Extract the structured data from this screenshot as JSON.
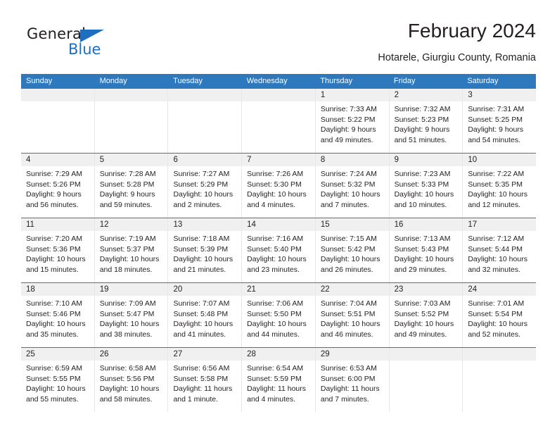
{
  "brand": {
    "name_top": "General",
    "name_bottom": "Blue",
    "accent_color": "#1f6fc0"
  },
  "header": {
    "title": "February 2024",
    "subtitle": "Hotarele, Giurgiu County, Romania"
  },
  "calendar": {
    "header_bg": "#2e78bd",
    "daynumber_bg": "#f0f0f0",
    "weekdays": [
      "Sunday",
      "Monday",
      "Tuesday",
      "Wednesday",
      "Thursday",
      "Friday",
      "Saturday"
    ],
    "weeks": [
      [
        {
          "day": "",
          "lines": []
        },
        {
          "day": "",
          "lines": []
        },
        {
          "day": "",
          "lines": []
        },
        {
          "day": "",
          "lines": []
        },
        {
          "day": "1",
          "lines": [
            "Sunrise: 7:33 AM",
            "Sunset: 5:22 PM",
            "Daylight: 9 hours",
            "and 49 minutes."
          ]
        },
        {
          "day": "2",
          "lines": [
            "Sunrise: 7:32 AM",
            "Sunset: 5:23 PM",
            "Daylight: 9 hours",
            "and 51 minutes."
          ]
        },
        {
          "day": "3",
          "lines": [
            "Sunrise: 7:31 AM",
            "Sunset: 5:25 PM",
            "Daylight: 9 hours",
            "and 54 minutes."
          ]
        }
      ],
      [
        {
          "day": "4",
          "lines": [
            "Sunrise: 7:29 AM",
            "Sunset: 5:26 PM",
            "Daylight: 9 hours",
            "and 56 minutes."
          ]
        },
        {
          "day": "5",
          "lines": [
            "Sunrise: 7:28 AM",
            "Sunset: 5:28 PM",
            "Daylight: 9 hours",
            "and 59 minutes."
          ]
        },
        {
          "day": "6",
          "lines": [
            "Sunrise: 7:27 AM",
            "Sunset: 5:29 PM",
            "Daylight: 10 hours",
            "and 2 minutes."
          ]
        },
        {
          "day": "7",
          "lines": [
            "Sunrise: 7:26 AM",
            "Sunset: 5:30 PM",
            "Daylight: 10 hours",
            "and 4 minutes."
          ]
        },
        {
          "day": "8",
          "lines": [
            "Sunrise: 7:24 AM",
            "Sunset: 5:32 PM",
            "Daylight: 10 hours",
            "and 7 minutes."
          ]
        },
        {
          "day": "9",
          "lines": [
            "Sunrise: 7:23 AM",
            "Sunset: 5:33 PM",
            "Daylight: 10 hours",
            "and 10 minutes."
          ]
        },
        {
          "day": "10",
          "lines": [
            "Sunrise: 7:22 AM",
            "Sunset: 5:35 PM",
            "Daylight: 10 hours",
            "and 12 minutes."
          ]
        }
      ],
      [
        {
          "day": "11",
          "lines": [
            "Sunrise: 7:20 AM",
            "Sunset: 5:36 PM",
            "Daylight: 10 hours",
            "and 15 minutes."
          ]
        },
        {
          "day": "12",
          "lines": [
            "Sunrise: 7:19 AM",
            "Sunset: 5:37 PM",
            "Daylight: 10 hours",
            "and 18 minutes."
          ]
        },
        {
          "day": "13",
          "lines": [
            "Sunrise: 7:18 AM",
            "Sunset: 5:39 PM",
            "Daylight: 10 hours",
            "and 21 minutes."
          ]
        },
        {
          "day": "14",
          "lines": [
            "Sunrise: 7:16 AM",
            "Sunset: 5:40 PM",
            "Daylight: 10 hours",
            "and 23 minutes."
          ]
        },
        {
          "day": "15",
          "lines": [
            "Sunrise: 7:15 AM",
            "Sunset: 5:42 PM",
            "Daylight: 10 hours",
            "and 26 minutes."
          ]
        },
        {
          "day": "16",
          "lines": [
            "Sunrise: 7:13 AM",
            "Sunset: 5:43 PM",
            "Daylight: 10 hours",
            "and 29 minutes."
          ]
        },
        {
          "day": "17",
          "lines": [
            "Sunrise: 7:12 AM",
            "Sunset: 5:44 PM",
            "Daylight: 10 hours",
            "and 32 minutes."
          ]
        }
      ],
      [
        {
          "day": "18",
          "lines": [
            "Sunrise: 7:10 AM",
            "Sunset: 5:46 PM",
            "Daylight: 10 hours",
            "and 35 minutes."
          ]
        },
        {
          "day": "19",
          "lines": [
            "Sunrise: 7:09 AM",
            "Sunset: 5:47 PM",
            "Daylight: 10 hours",
            "and 38 minutes."
          ]
        },
        {
          "day": "20",
          "lines": [
            "Sunrise: 7:07 AM",
            "Sunset: 5:48 PM",
            "Daylight: 10 hours",
            "and 41 minutes."
          ]
        },
        {
          "day": "21",
          "lines": [
            "Sunrise: 7:06 AM",
            "Sunset: 5:50 PM",
            "Daylight: 10 hours",
            "and 44 minutes."
          ]
        },
        {
          "day": "22",
          "lines": [
            "Sunrise: 7:04 AM",
            "Sunset: 5:51 PM",
            "Daylight: 10 hours",
            "and 46 minutes."
          ]
        },
        {
          "day": "23",
          "lines": [
            "Sunrise: 7:03 AM",
            "Sunset: 5:52 PM",
            "Daylight: 10 hours",
            "and 49 minutes."
          ]
        },
        {
          "day": "24",
          "lines": [
            "Sunrise: 7:01 AM",
            "Sunset: 5:54 PM",
            "Daylight: 10 hours",
            "and 52 minutes."
          ]
        }
      ],
      [
        {
          "day": "25",
          "lines": [
            "Sunrise: 6:59 AM",
            "Sunset: 5:55 PM",
            "Daylight: 10 hours",
            "and 55 minutes."
          ]
        },
        {
          "day": "26",
          "lines": [
            "Sunrise: 6:58 AM",
            "Sunset: 5:56 PM",
            "Daylight: 10 hours",
            "and 58 minutes."
          ]
        },
        {
          "day": "27",
          "lines": [
            "Sunrise: 6:56 AM",
            "Sunset: 5:58 PM",
            "Daylight: 11 hours",
            "and 1 minute."
          ]
        },
        {
          "day": "28",
          "lines": [
            "Sunrise: 6:54 AM",
            "Sunset: 5:59 PM",
            "Daylight: 11 hours",
            "and 4 minutes."
          ]
        },
        {
          "day": "29",
          "lines": [
            "Sunrise: 6:53 AM",
            "Sunset: 6:00 PM",
            "Daylight: 11 hours",
            "and 7 minutes."
          ]
        },
        {
          "day": "",
          "lines": []
        },
        {
          "day": "",
          "lines": []
        }
      ]
    ]
  }
}
